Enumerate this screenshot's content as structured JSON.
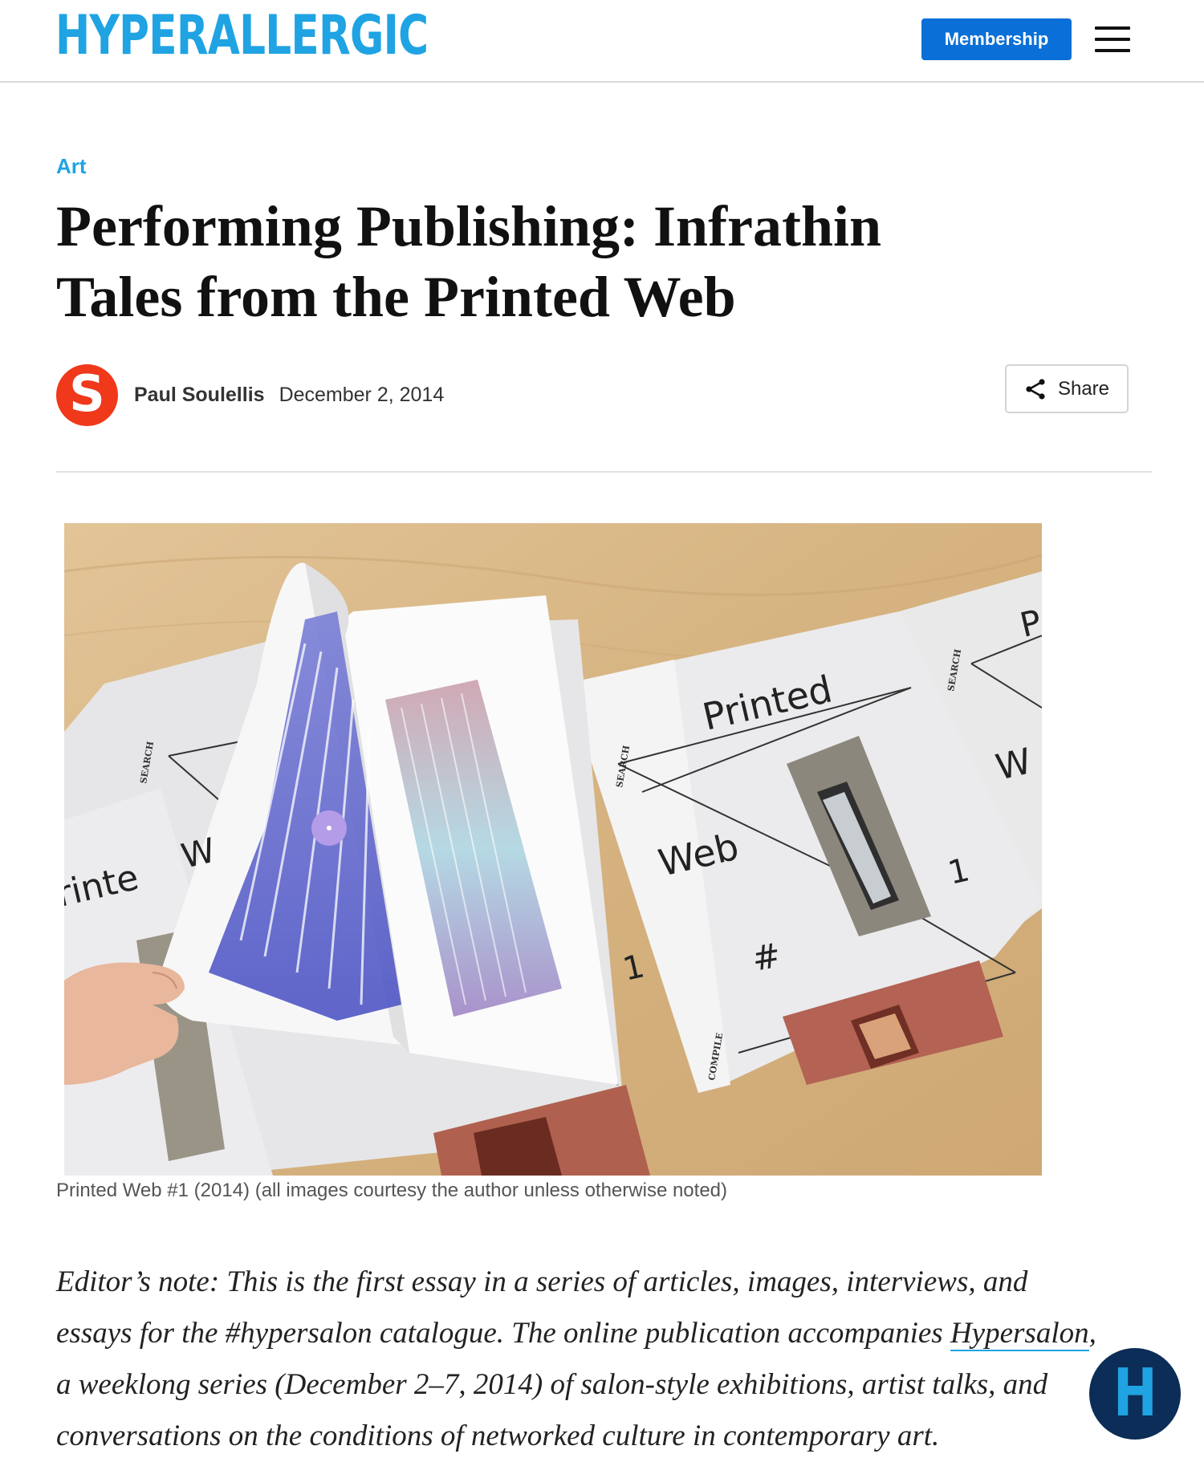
{
  "header": {
    "logo_text": "HYPERALLERGIC",
    "membership_label": "Membership",
    "menu_icon": "hamburger-icon"
  },
  "article": {
    "category": "Art",
    "title": "Performing Publishing: Infrathin Tales from the Printed Web",
    "author_initial": "S",
    "author": "Paul Soulellis",
    "date": "December 2, 2014",
    "share_label": "Share",
    "figure": {
      "caption": "Printed Web #1 (2014) (all images courtesy the author unless otherwise noted)",
      "visible_text": {
        "printed": "Printed",
        "web": "Web",
        "hash": "#",
        "one": "1",
        "search": "SEARCH",
        "compile": "COMPILE",
        "left_printed": "rinte",
        "left_w": "W",
        "right_w": "W",
        "right_p": "P"
      }
    },
    "intro": {
      "part1": "Editor’s note: This is the first essay in a series of articles, images, interviews, and essays for the #hypersalon catalogue. The online publication accompanies ",
      "link_text": "Hypersalon",
      "part2": ", a weeklong series (December 2–7, 2014) of salon-style exhibitions, artist talks, and conversations on the conditions of networked culture in contemporary art."
    }
  },
  "floating_badge": {
    "letter": "H"
  },
  "colors": {
    "brand_blue": "#1fa3e3",
    "button_blue": "#0a6fd6",
    "avatar_red": "#f0381b",
    "badge_navy": "#0b2d57"
  }
}
